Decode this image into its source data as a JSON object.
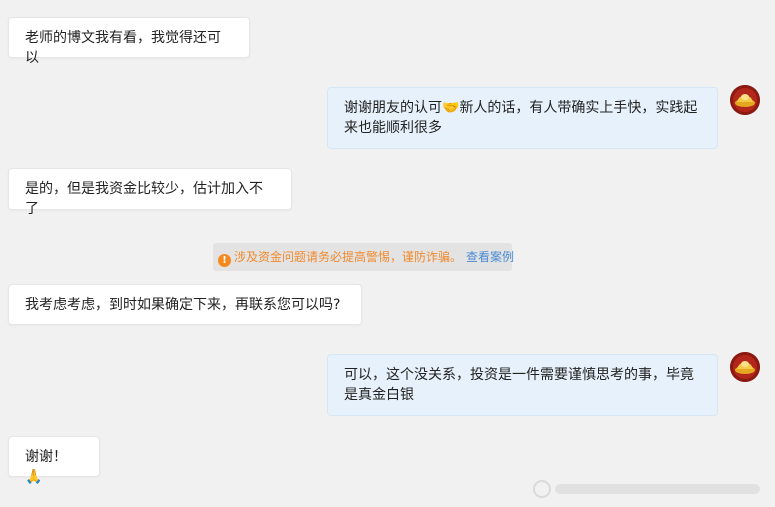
{
  "messages": [
    {
      "side": "in",
      "text": "老师的博文我有看，我觉得还可以"
    },
    {
      "side": "out",
      "text_before": "谢谢朋友的认可",
      "emoji": "🤝",
      "text_after": "新人的话，有人带确实上手快，实践起来也能顺利很多",
      "avatar_icon": "gold-ingot-avatar"
    },
    {
      "side": "in",
      "text": "是的，但是我资金比较少，估计加入不了"
    },
    {
      "side": "in",
      "text": "我考虑考虑，到时如果确定下来，再联系您可以吗?"
    },
    {
      "side": "out",
      "text": "可以，这个没关系，投资是一件需要谨慎思考的事，毕竟是真金白银",
      "avatar_icon": "gold-ingot-avatar"
    },
    {
      "side": "in",
      "text": "谢谢！",
      "emoji": "🙏"
    }
  ],
  "notice": {
    "icon": "warning-icon",
    "text": "涉及资金问题请务必提高警惕，谨防诈骗。",
    "link": "查看案例"
  },
  "colors": {
    "background": "#f1f1f1",
    "incoming_bubble": "#ffffff",
    "outgoing_bubble": "#e6f1fb",
    "notice_text": "#f08a2e",
    "notice_link": "#4a8ad4",
    "avatar": "#8a1a12"
  }
}
